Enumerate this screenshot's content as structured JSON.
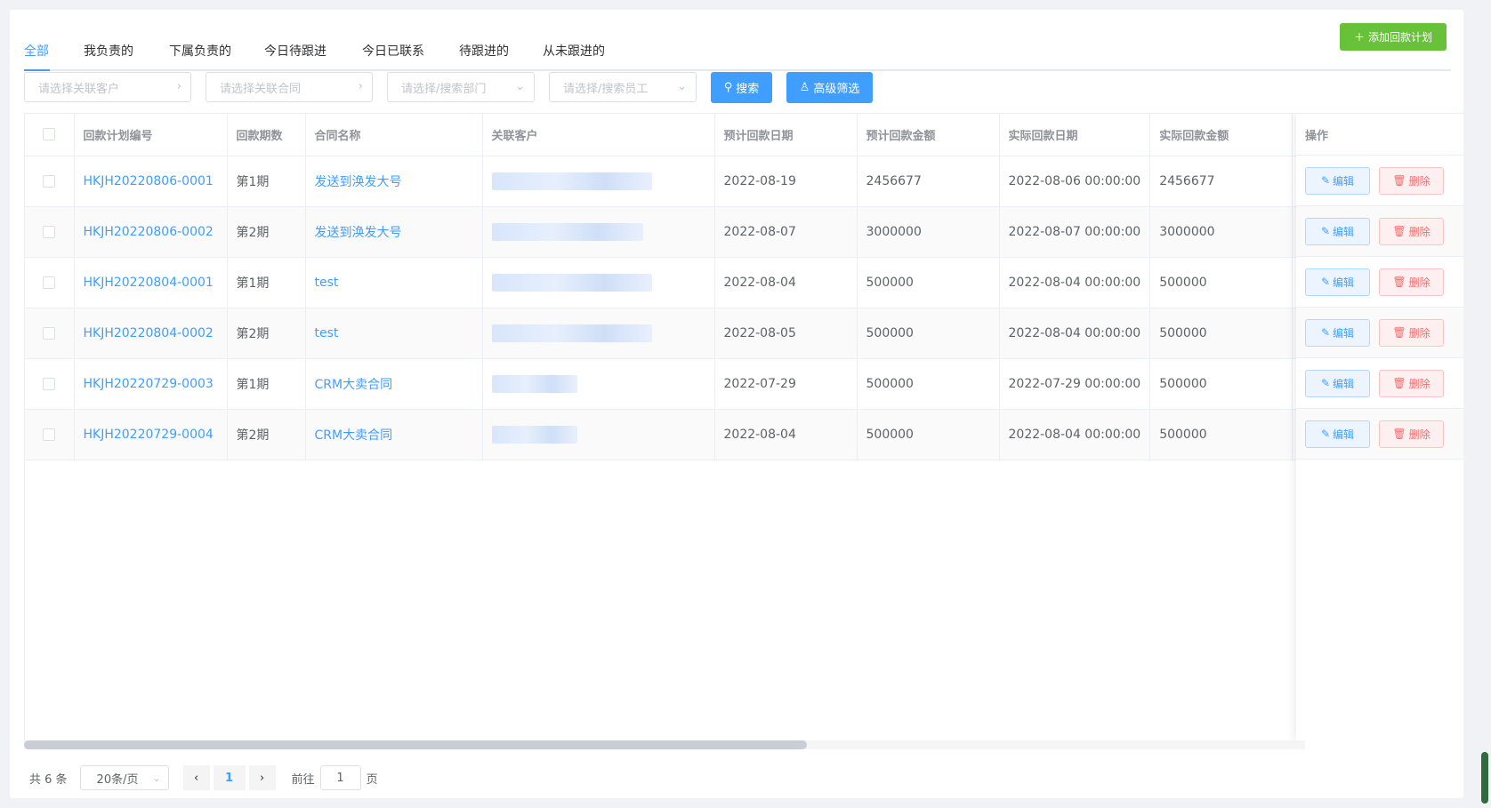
{
  "tabs": [
    {
      "label": "全部",
      "active": true
    },
    {
      "label": "我负责的",
      "active": false
    },
    {
      "label": "下属负责的",
      "active": false
    },
    {
      "label": "今日待跟进",
      "active": false
    },
    {
      "label": "今日已联系",
      "active": false
    },
    {
      "label": "待跟进的",
      "active": false
    },
    {
      "label": "从未跟进的",
      "active": false
    }
  ],
  "toolbar": {
    "add_plan_label": "添加回款计划"
  },
  "filters": {
    "customer_placeholder": "请选择关联客户",
    "contract_placeholder": "请选择关联合同",
    "department_placeholder": "请选择/搜索部门",
    "employee_placeholder": "请选择/搜索员工",
    "search_label": "搜索",
    "advanced_label": "高级筛选"
  },
  "table": {
    "columns": [
      "回款计划编号",
      "回款期数",
      "合同名称",
      "关联客户",
      "预计回款日期",
      "预计回款金额",
      "实际回款日期",
      "实际回款金额",
      "操作"
    ],
    "rows": [
      {
        "plan_no": "HKJH20220806-0001",
        "period": "第1期",
        "contract": "发送到涣发大号",
        "expected_date": "2022-08-19",
        "expected_amount": "2456677",
        "actual_date": "2022-08-06 00:00:00",
        "actual_amount": "2456677"
      },
      {
        "plan_no": "HKJH20220806-0002",
        "period": "第2期",
        "contract": "发送到涣发大号",
        "expected_date": "2022-08-07",
        "expected_amount": "3000000",
        "actual_date": "2022-08-07 00:00:00",
        "actual_amount": "3000000"
      },
      {
        "plan_no": "HKJH20220804-0001",
        "period": "第1期",
        "contract": "test",
        "expected_date": "2022-08-04",
        "expected_amount": "500000",
        "actual_date": "2022-08-04 00:00:00",
        "actual_amount": "500000"
      },
      {
        "plan_no": "HKJH20220804-0002",
        "period": "第2期",
        "contract": "test",
        "expected_date": "2022-08-05",
        "expected_amount": "500000",
        "actual_date": "2022-08-04 00:00:00",
        "actual_amount": "500000"
      },
      {
        "plan_no": "HKJH20220729-0003",
        "period": "第1期",
        "contract": "CRM大卖合同",
        "expected_date": "2022-07-29",
        "expected_amount": "500000",
        "actual_date": "2022-07-29 00:00:00",
        "actual_amount": "500000"
      },
      {
        "plan_no": "HKJH20220729-0004",
        "period": "第2期",
        "contract": "CRM大卖合同",
        "expected_date": "2022-08-04",
        "expected_amount": "500000",
        "actual_date": "2022-08-04 00:00:00",
        "actual_amount": "500000"
      }
    ],
    "edit_label": "编辑",
    "delete_label": "删除"
  },
  "pagination": {
    "total_text": "共 6 条",
    "page_size": "20条/页",
    "current_page": "1",
    "goto_label": "前往",
    "goto_value": "1",
    "page_suffix": "页"
  },
  "colors": {
    "primary": "#409eff",
    "success": "#67c23a",
    "danger": "#f56c6c"
  }
}
